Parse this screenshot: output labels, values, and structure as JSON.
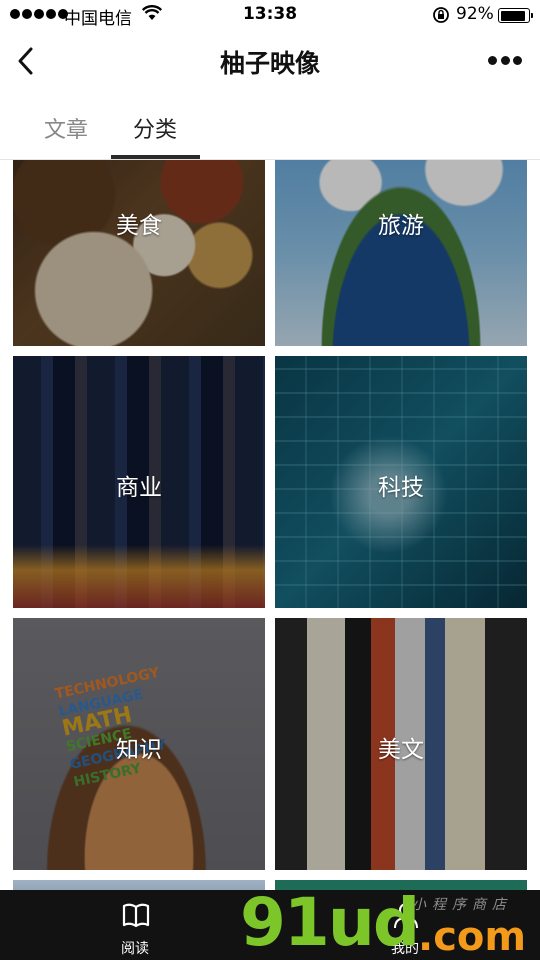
{
  "status_bar": {
    "carrier": "中国电信",
    "time": "13:38",
    "battery_percent": "92%",
    "battery_level": 0.92
  },
  "nav": {
    "title": "柚子映像"
  },
  "tabs": [
    {
      "label": "文章",
      "active": false
    },
    {
      "label": "分类",
      "active": true
    }
  ],
  "categories": [
    {
      "label": "美食"
    },
    {
      "label": "旅游"
    },
    {
      "label": "商业"
    },
    {
      "label": "科技"
    },
    {
      "label": "知识"
    },
    {
      "label": "美文"
    }
  ],
  "knowledge_image_words": [
    "TECHNOLOGY",
    "LANGUAGE",
    "MATH",
    "SCIENCE",
    "GEOGRAPHY",
    "HISTORY"
  ],
  "tab_bar": {
    "items": [
      {
        "label": "阅读",
        "icon": "book-icon"
      },
      {
        "label": "我的",
        "icon": "user-icon"
      }
    ]
  },
  "watermark": {
    "brand": "91ud",
    "suffix": ".com",
    "tagline": "小程序商店"
  },
  "colors": {
    "tab_bar_bg": "#121212",
    "active_tab_underline": "#2a2a2a",
    "watermark_green": "#7cc62a",
    "watermark_orange": "#f39a1a"
  }
}
